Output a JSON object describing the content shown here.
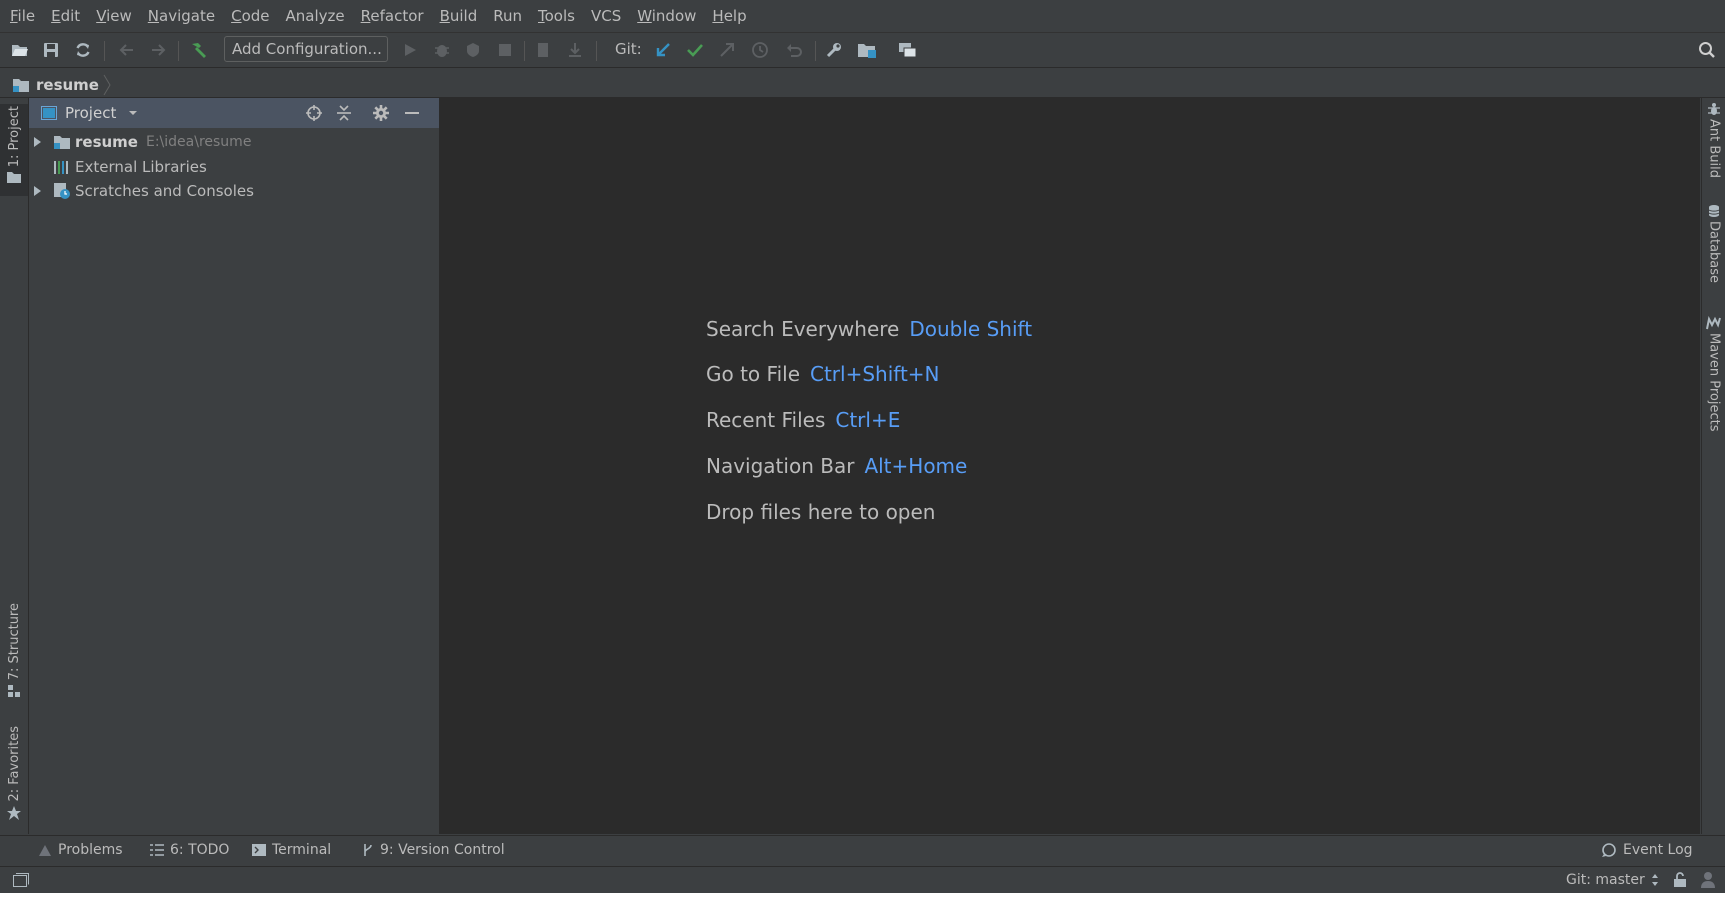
{
  "menu": [
    {
      "label": "File",
      "mnemonic": "F",
      "rest": "ile"
    },
    {
      "label": "Edit",
      "mnemonic": "E",
      "rest": "dit"
    },
    {
      "label": "View",
      "mnemonic": "V",
      "rest": "iew"
    },
    {
      "label": "Navigate",
      "mnemonic": "N",
      "rest": "avigate"
    },
    {
      "label": "Code",
      "mnemonic": "C",
      "rest": "ode"
    },
    {
      "label": "Analyze",
      "mnemonic": "",
      "rest": "Analyze"
    },
    {
      "label": "Refactor",
      "mnemonic": "R",
      "rest": "efactor"
    },
    {
      "label": "Build",
      "mnemonic": "B",
      "rest": "uild"
    },
    {
      "label": "Run",
      "mnemonic": "",
      "rest": "Run"
    },
    {
      "label": "Tools",
      "mnemonic": "T",
      "rest": "ools"
    },
    {
      "label": "VCS",
      "mnemonic": "",
      "rest": "VCS"
    },
    {
      "label": "Window",
      "mnemonic": "W",
      "rest": "indow"
    },
    {
      "label": "Help",
      "mnemonic": "H",
      "rest": "elp"
    }
  ],
  "toolbar": {
    "add_configuration": "Add Configuration...",
    "git_label": "Git:"
  },
  "breadcrumb": {
    "project": "resume"
  },
  "left_stripe": {
    "project_tab": "1: Project",
    "structure_tab": "7: Structure",
    "favorites_tab": "2: Favorites"
  },
  "project_panel": {
    "title": "Project",
    "tree": [
      {
        "label": "resume",
        "path": "E:\\idea\\resume",
        "bold": true,
        "expandable": true
      },
      {
        "label": "External Libraries",
        "path": "",
        "bold": false,
        "expandable": false
      },
      {
        "label": "Scratches and Consoles",
        "path": "",
        "bold": false,
        "expandable": true
      }
    ]
  },
  "editor": {
    "hints": [
      {
        "action": "Search Everywhere",
        "shortcut": "Double Shift"
      },
      {
        "action": "Go to File",
        "shortcut": "Ctrl+Shift+N"
      },
      {
        "action": "Recent Files",
        "shortcut": "Ctrl+E"
      },
      {
        "action": "Navigation Bar",
        "shortcut": "Alt+Home"
      }
    ],
    "drop_text": "Drop files here to open"
  },
  "right_stripe": {
    "ant_build": "Ant Build",
    "database": "Database",
    "maven": "Maven Projects"
  },
  "bottom_tabs": {
    "problems": "Problems",
    "todo": "6: TODO",
    "terminal": "Terminal",
    "version_control": "9: Version Control",
    "event_log": "Event Log"
  },
  "status": {
    "git_branch": "Git: master"
  },
  "colors": {
    "background": "#3c3f41",
    "editor": "#2b2b2b",
    "accent_link": "#589df6",
    "header_selected": "#4b5462",
    "green": "#499c54"
  }
}
